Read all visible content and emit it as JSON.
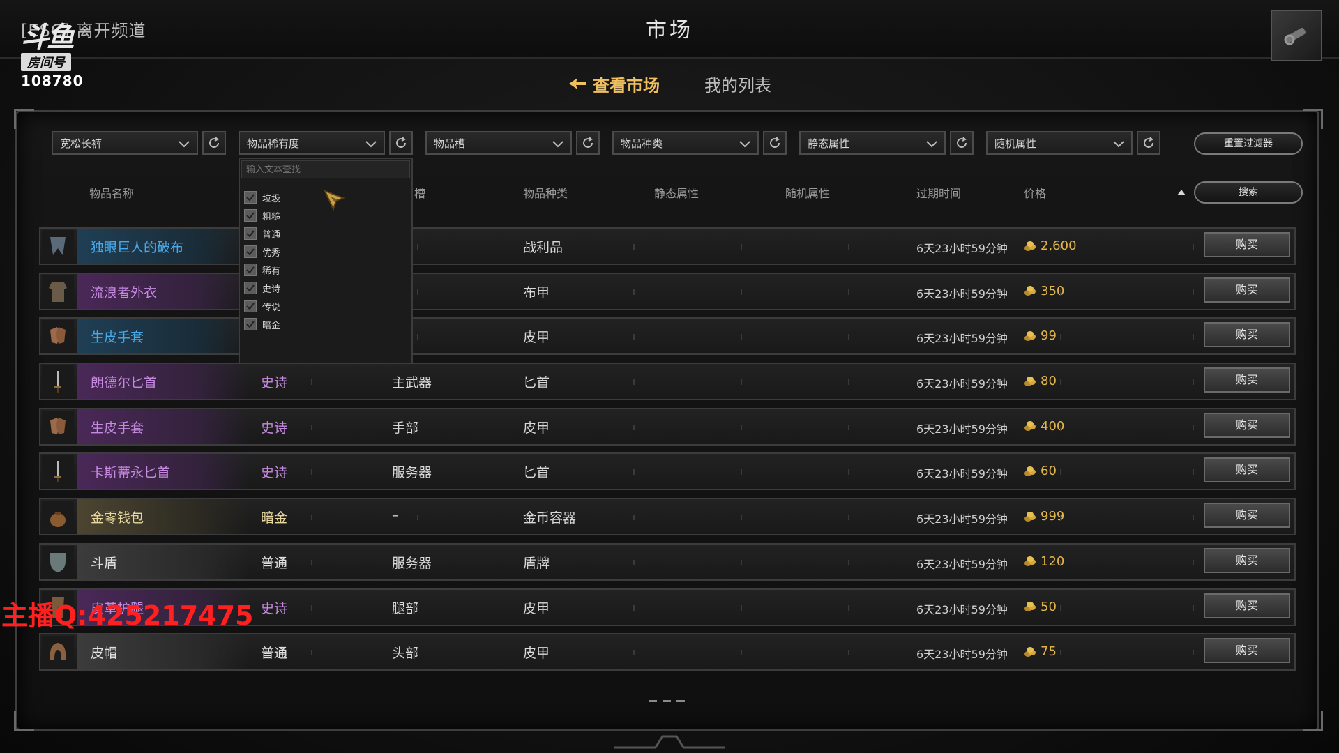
{
  "header": {
    "esc_label": "[ESC] 离开频道",
    "title": "市场"
  },
  "logo": {
    "brand": "斗鱼",
    "room_tag": "房间号",
    "room_number": "108780"
  },
  "tabs": [
    {
      "label": "查看市场",
      "active": true
    },
    {
      "label": "我的列表",
      "active": false
    }
  ],
  "filters": {
    "item_name": "宽松长裤",
    "rarity": "物品稀有度",
    "slot": "物品槽",
    "type": "物品种类",
    "static_attr": "静态属性",
    "random_attr": "随机属性",
    "reset_label": "重置过滤器",
    "search_label": "搜索"
  },
  "columns": {
    "name": "物品名称",
    "slot": "槽",
    "type": "物品种类",
    "static": "静态属性",
    "random": "随机属性",
    "expire": "过期时间",
    "price": "价格"
  },
  "rarity_dropdown": {
    "search_placeholder": "输入文本查找",
    "options": [
      {
        "label": "垃圾",
        "checked": true
      },
      {
        "label": "粗糙",
        "checked": true
      },
      {
        "label": "普通",
        "checked": true
      },
      {
        "label": "优秀",
        "checked": true
      },
      {
        "label": "稀有",
        "checked": true
      },
      {
        "label": "史诗",
        "checked": true
      },
      {
        "label": "传说",
        "checked": true
      },
      {
        "label": "暗金",
        "checked": true
      }
    ]
  },
  "rows": [
    {
      "name": "独眼巨人的破布",
      "rarity": "",
      "slot": "",
      "type": "战利品",
      "expire": "6天23小时59分钟",
      "price": "2,600",
      "buy": "购买",
      "tone": "blue",
      "icon": "cloth-icon"
    },
    {
      "name": "流浪者外衣",
      "rarity": "",
      "slot": "部",
      "type": "布甲",
      "expire": "6天23小时59分钟",
      "price": "350",
      "buy": "购买",
      "tone": "purple",
      "icon": "armor-icon"
    },
    {
      "name": "生皮手套",
      "rarity": "",
      "slot": "部",
      "type": "皮甲",
      "expire": "6天23小时59分钟",
      "price": "99",
      "buy": "购买",
      "tone": "blue",
      "icon": "gloves-icon"
    },
    {
      "name": "朗德尔匕首",
      "rarity": "史诗",
      "slot": "主武器",
      "type": "匕首",
      "expire": "6天23小时59分钟",
      "price": "80",
      "buy": "购买",
      "tone": "purple",
      "icon": "dagger-icon"
    },
    {
      "name": "生皮手套",
      "rarity": "史诗",
      "slot": "手部",
      "type": "皮甲",
      "expire": "6天23小时59分钟",
      "price": "400",
      "buy": "购买",
      "tone": "purple",
      "icon": "gloves-icon"
    },
    {
      "name": "卡斯蒂永匕首",
      "rarity": "史诗",
      "slot": "服务器",
      "type": "匕首",
      "expire": "6天23小时59分钟",
      "price": "60",
      "buy": "购买",
      "tone": "purple",
      "icon": "dagger-icon"
    },
    {
      "name": "金零钱包",
      "rarity": "暗金",
      "slot": "–",
      "type": "金币容器",
      "expire": "6天23小时59分钟",
      "price": "999",
      "buy": "购买",
      "tone": "gold",
      "icon": "pouch-icon"
    },
    {
      "name": "斗盾",
      "rarity": "普通",
      "slot": "服务器",
      "type": "盾牌",
      "expire": "6天23小时59分钟",
      "price": "120",
      "buy": "购买",
      "tone": "gray",
      "icon": "shield-icon"
    },
    {
      "name": "皮革护腿",
      "rarity": "史诗",
      "slot": "腿部",
      "type": "皮甲",
      "expire": "6天23小时59分钟",
      "price": "50",
      "buy": "购买",
      "tone": "purple",
      "icon": "leggings-icon"
    },
    {
      "name": "皮帽",
      "rarity": "普通",
      "slot": "头部",
      "type": "皮甲",
      "expire": "6天23小时59分钟",
      "price": "75",
      "buy": "购买",
      "tone": "gray",
      "icon": "hood-icon"
    }
  ],
  "watermark": "主播Q:425217475",
  "colors": {
    "gold": "#e2b54a",
    "epic": "#c58ae0",
    "rare": "#4aa8e8",
    "tab_active": "#f0c060"
  }
}
